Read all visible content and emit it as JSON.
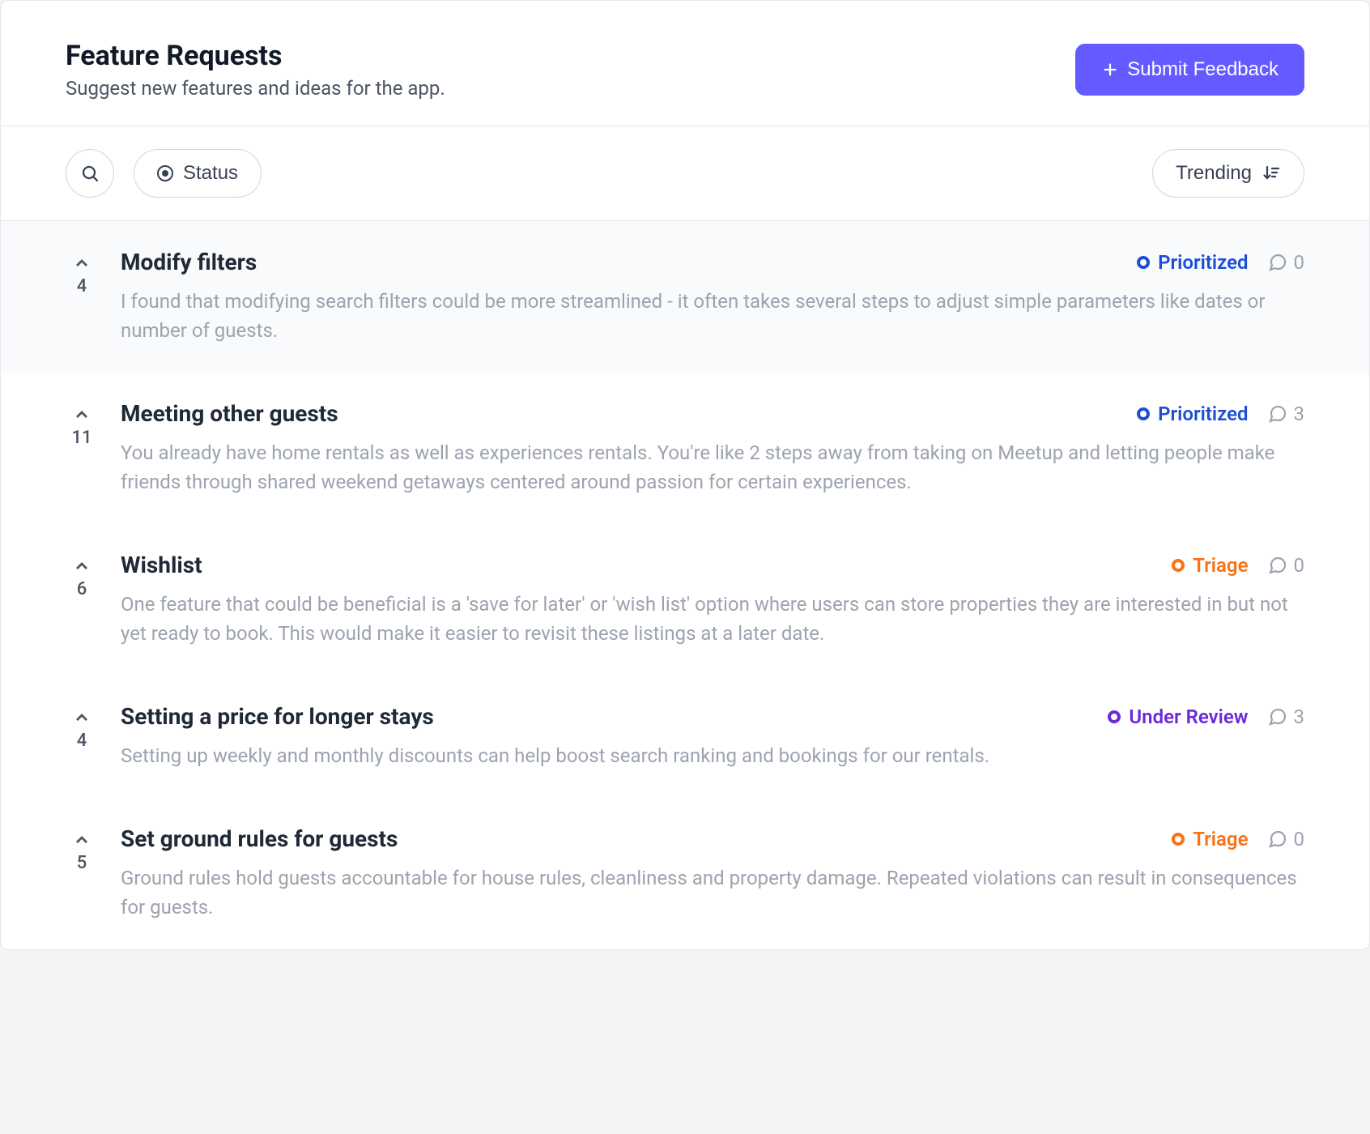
{
  "header": {
    "title": "Feature Requests",
    "subtitle": "Suggest new features and ideas for the app.",
    "submit_label": "Submit Feedback"
  },
  "toolbar": {
    "status_label": "Status",
    "sort_label": "Trending"
  },
  "items": [
    {
      "votes": "4",
      "title": "Modify filters",
      "status_label": "Prioritized",
      "status_class": "prioritized",
      "comments": "0",
      "description": "I found that modifying search filters could be more streamlined - it often takes several steps to adjust simple parameters like dates or number of guests.",
      "highlight": true
    },
    {
      "votes": "11",
      "title": "Meeting other guests",
      "status_label": "Prioritized",
      "status_class": "prioritized",
      "comments": "3",
      "description": "You already have home rentals as well as experiences rentals. You're like 2 steps away from taking on Meetup and letting people make friends through shared weekend getaways centered around passion for certain experiences.",
      "highlight": false
    },
    {
      "votes": "6",
      "title": "Wishlist",
      "status_label": "Triage",
      "status_class": "triage",
      "comments": "0",
      "description": "One feature that could be beneficial is a 'save for later' or 'wish list' option where users can store properties they are interested in but not yet ready to book. This would make it easier to revisit these listings at a later date.",
      "highlight": false
    },
    {
      "votes": "4",
      "title": "Setting a price for longer stays",
      "status_label": "Under Review",
      "status_class": "under-review",
      "comments": "3",
      "description": "Setting up weekly and monthly discounts can help boost search ranking and bookings for our rentals.",
      "highlight": false
    },
    {
      "votes": "5",
      "title": "Set ground rules for guests",
      "status_label": "Triage",
      "status_class": "triage",
      "comments": "0",
      "description": "Ground rules hold guests accountable for house rules, cleanliness and property damage. Repeated violations can result in consequences for guests.",
      "highlight": false
    }
  ]
}
